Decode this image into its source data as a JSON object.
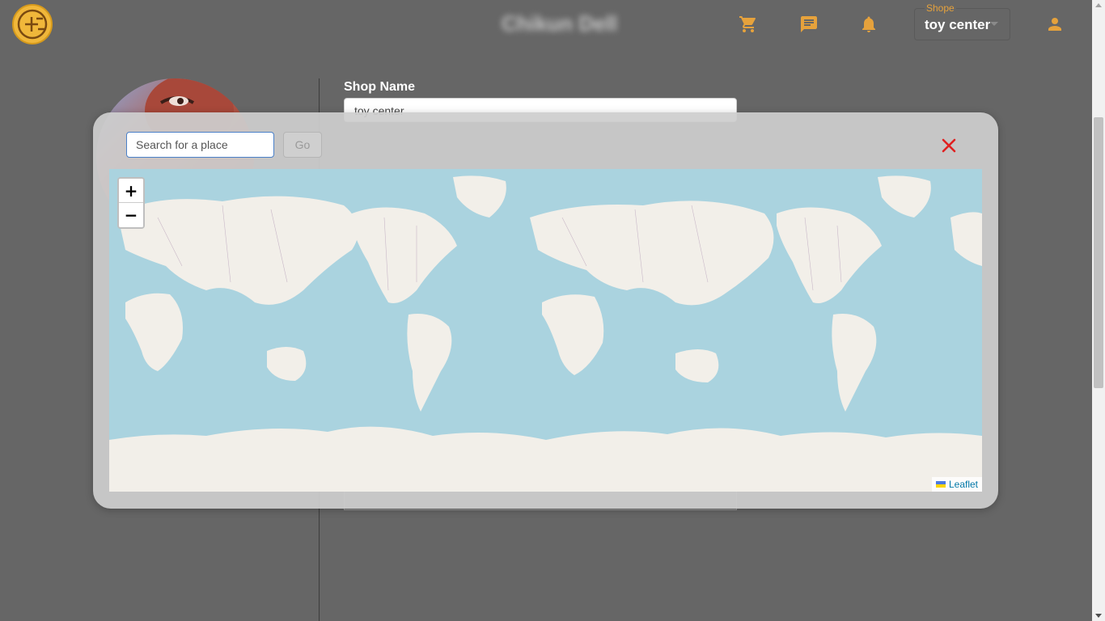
{
  "header": {
    "brand": "Chikun Dell",
    "icons": [
      "cart-icon",
      "chat-icon",
      "bell-icon",
      "user-icon"
    ],
    "shop_select": {
      "label": "Shope",
      "value": "toy center"
    }
  },
  "form": {
    "shop_name_label": "Shop Name",
    "shop_name_value": "toy center"
  },
  "map_modal": {
    "search_placeholder": "Search for a place",
    "go_label": "Go",
    "zoom_in_label": "+",
    "zoom_out_label": "−",
    "attribution": "Leaflet"
  },
  "colors": {
    "accent": "#e6a23c",
    "ocean": "#aad3df",
    "land": "#f2efe9",
    "close": "#e02020"
  }
}
